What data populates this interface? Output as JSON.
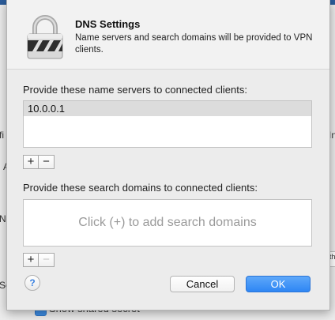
{
  "header": {
    "title": "DNS Settings",
    "description": "Name servers and search domains will be provided to VPN clients."
  },
  "name_servers": {
    "label": "Provide these name servers to connected clients:",
    "items": [
      "10.0.0.1"
    ],
    "add_label": "+",
    "remove_label": "−"
  },
  "search_domains": {
    "label": "Provide these search domains to connected clients:",
    "placeholder": "Click (+) to add search domains",
    "add_label": "+",
    "remove_label": "−"
  },
  "footer": {
    "help_label": "?",
    "cancel_label": "Cancel",
    "ok_label": "OK"
  },
  "background": {
    "frag_fi": "fi",
    "frag_in": "In",
    "frag_a": "A",
    "frag_n": "N",
    "frag_se": "Se",
    "frag_th": "th",
    "checkbox_label": "Show shared secret"
  }
}
